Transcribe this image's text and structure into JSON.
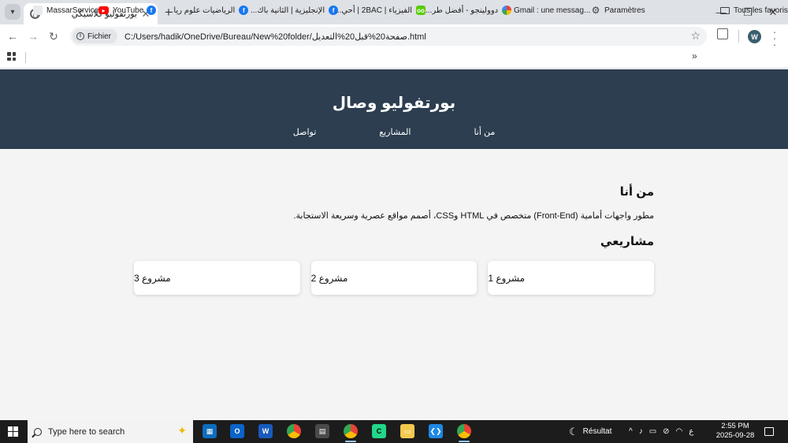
{
  "browser": {
    "tab_title": "بورتفوليو كلاسيكي",
    "close_glyph": "✕",
    "new_tab_glyph": "+",
    "window_controls": {
      "minimize": "—",
      "restore": "❐",
      "close": "✕"
    },
    "chip_label": "Fichier",
    "url": "C:/Users/hadik/OneDrive/Bureau/New%20folder/صفحة20%قبل20%التعديل.html",
    "profile_initial": "W",
    "bookmarks": [
      {
        "label": "MassarService",
        "icon": "massar-icon"
      },
      {
        "label": "YouTube",
        "icon": "youtube-icon"
      },
      {
        "label": "",
        "icon": "facebook-icon"
      },
      {
        "label": "الرياضيات علوم ريا...",
        "icon": "facebook-icon"
      },
      {
        "label": "الإنجليزية | الثانية باك...",
        "icon": "facebook-icon"
      },
      {
        "label": "الفيزياء | 2BAC | أحي...",
        "icon": "facebook-icon"
      },
      {
        "label": "دوولينجو - أفضل طر...",
        "icon": "duolingo-icon"
      },
      {
        "label": "Gmail : une messag...",
        "icon": "google-icon"
      },
      {
        "label": "Paramètres",
        "icon": "gear-icon"
      }
    ],
    "more_glyph": "»",
    "all_bookmarks": "Tous les favoris"
  },
  "site": {
    "title": "بورتفوليو وصال",
    "nav": [
      "من أنا",
      "المشاريع",
      "تواصل"
    ],
    "about_heading": "من أنا",
    "about_text": "مطور واجهات أمامية (Front-End) متخصص في HTML وCSS، أصمم مواقع عصرية وسريعة الاستجابة.",
    "projects_heading": "مشاريعي",
    "projects": [
      "مشروع 1",
      "مشروع 2",
      "مشروع 3"
    ]
  },
  "taskbar": {
    "search_placeholder": "Type here to search",
    "weather_label": "Résultat",
    "lang": "ع",
    "time": "2:55 PM",
    "date": "2025-09-28"
  },
  "colors": {
    "header_bg": "#2c3e50",
    "page_bg": "#f4f4f4",
    "card_bg": "#ffffff"
  }
}
